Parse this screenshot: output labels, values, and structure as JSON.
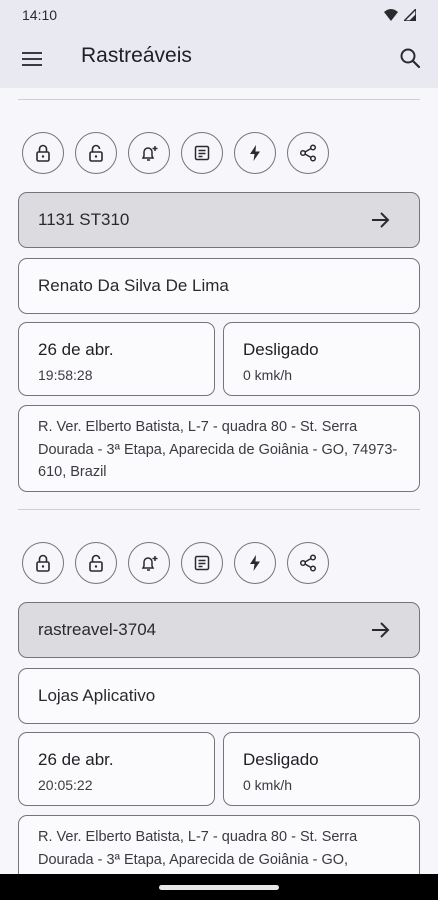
{
  "status_bar": {
    "time": "14:10"
  },
  "app_bar": {
    "title": "Rastreáveis"
  },
  "trackables": [
    {
      "id_label": "1131 ST310",
      "owner": "Renato Da Silva De Lima",
      "date": "26 de abr.",
      "time": "19:58:28",
      "ignition": "Desligado",
      "speed": "0 kmk/h",
      "address": "R. Ver. Elberto Batista, L-7 - quadra 80 - St. Serra Dourada - 3ª Etapa, Aparecida de Goiânia - GO, 74973-610, Brazil"
    },
    {
      "id_label": "rastreavel-3704",
      "owner": "Lojas Aplicativo",
      "date": "26 de abr.",
      "time": "20:05:22",
      "ignition": "Desligado",
      "speed": "0 kmk/h",
      "address": "R. Ver. Elberto Batista, L-7 - quadra 80 - St. Serra Dourada - 3ª Etapa, Aparecida de Goiânia - GO,"
    }
  ],
  "action_icons": [
    "lock-icon",
    "unlock-icon",
    "alert-add-icon",
    "report-icon",
    "bolt-icon",
    "share-icon"
  ]
}
